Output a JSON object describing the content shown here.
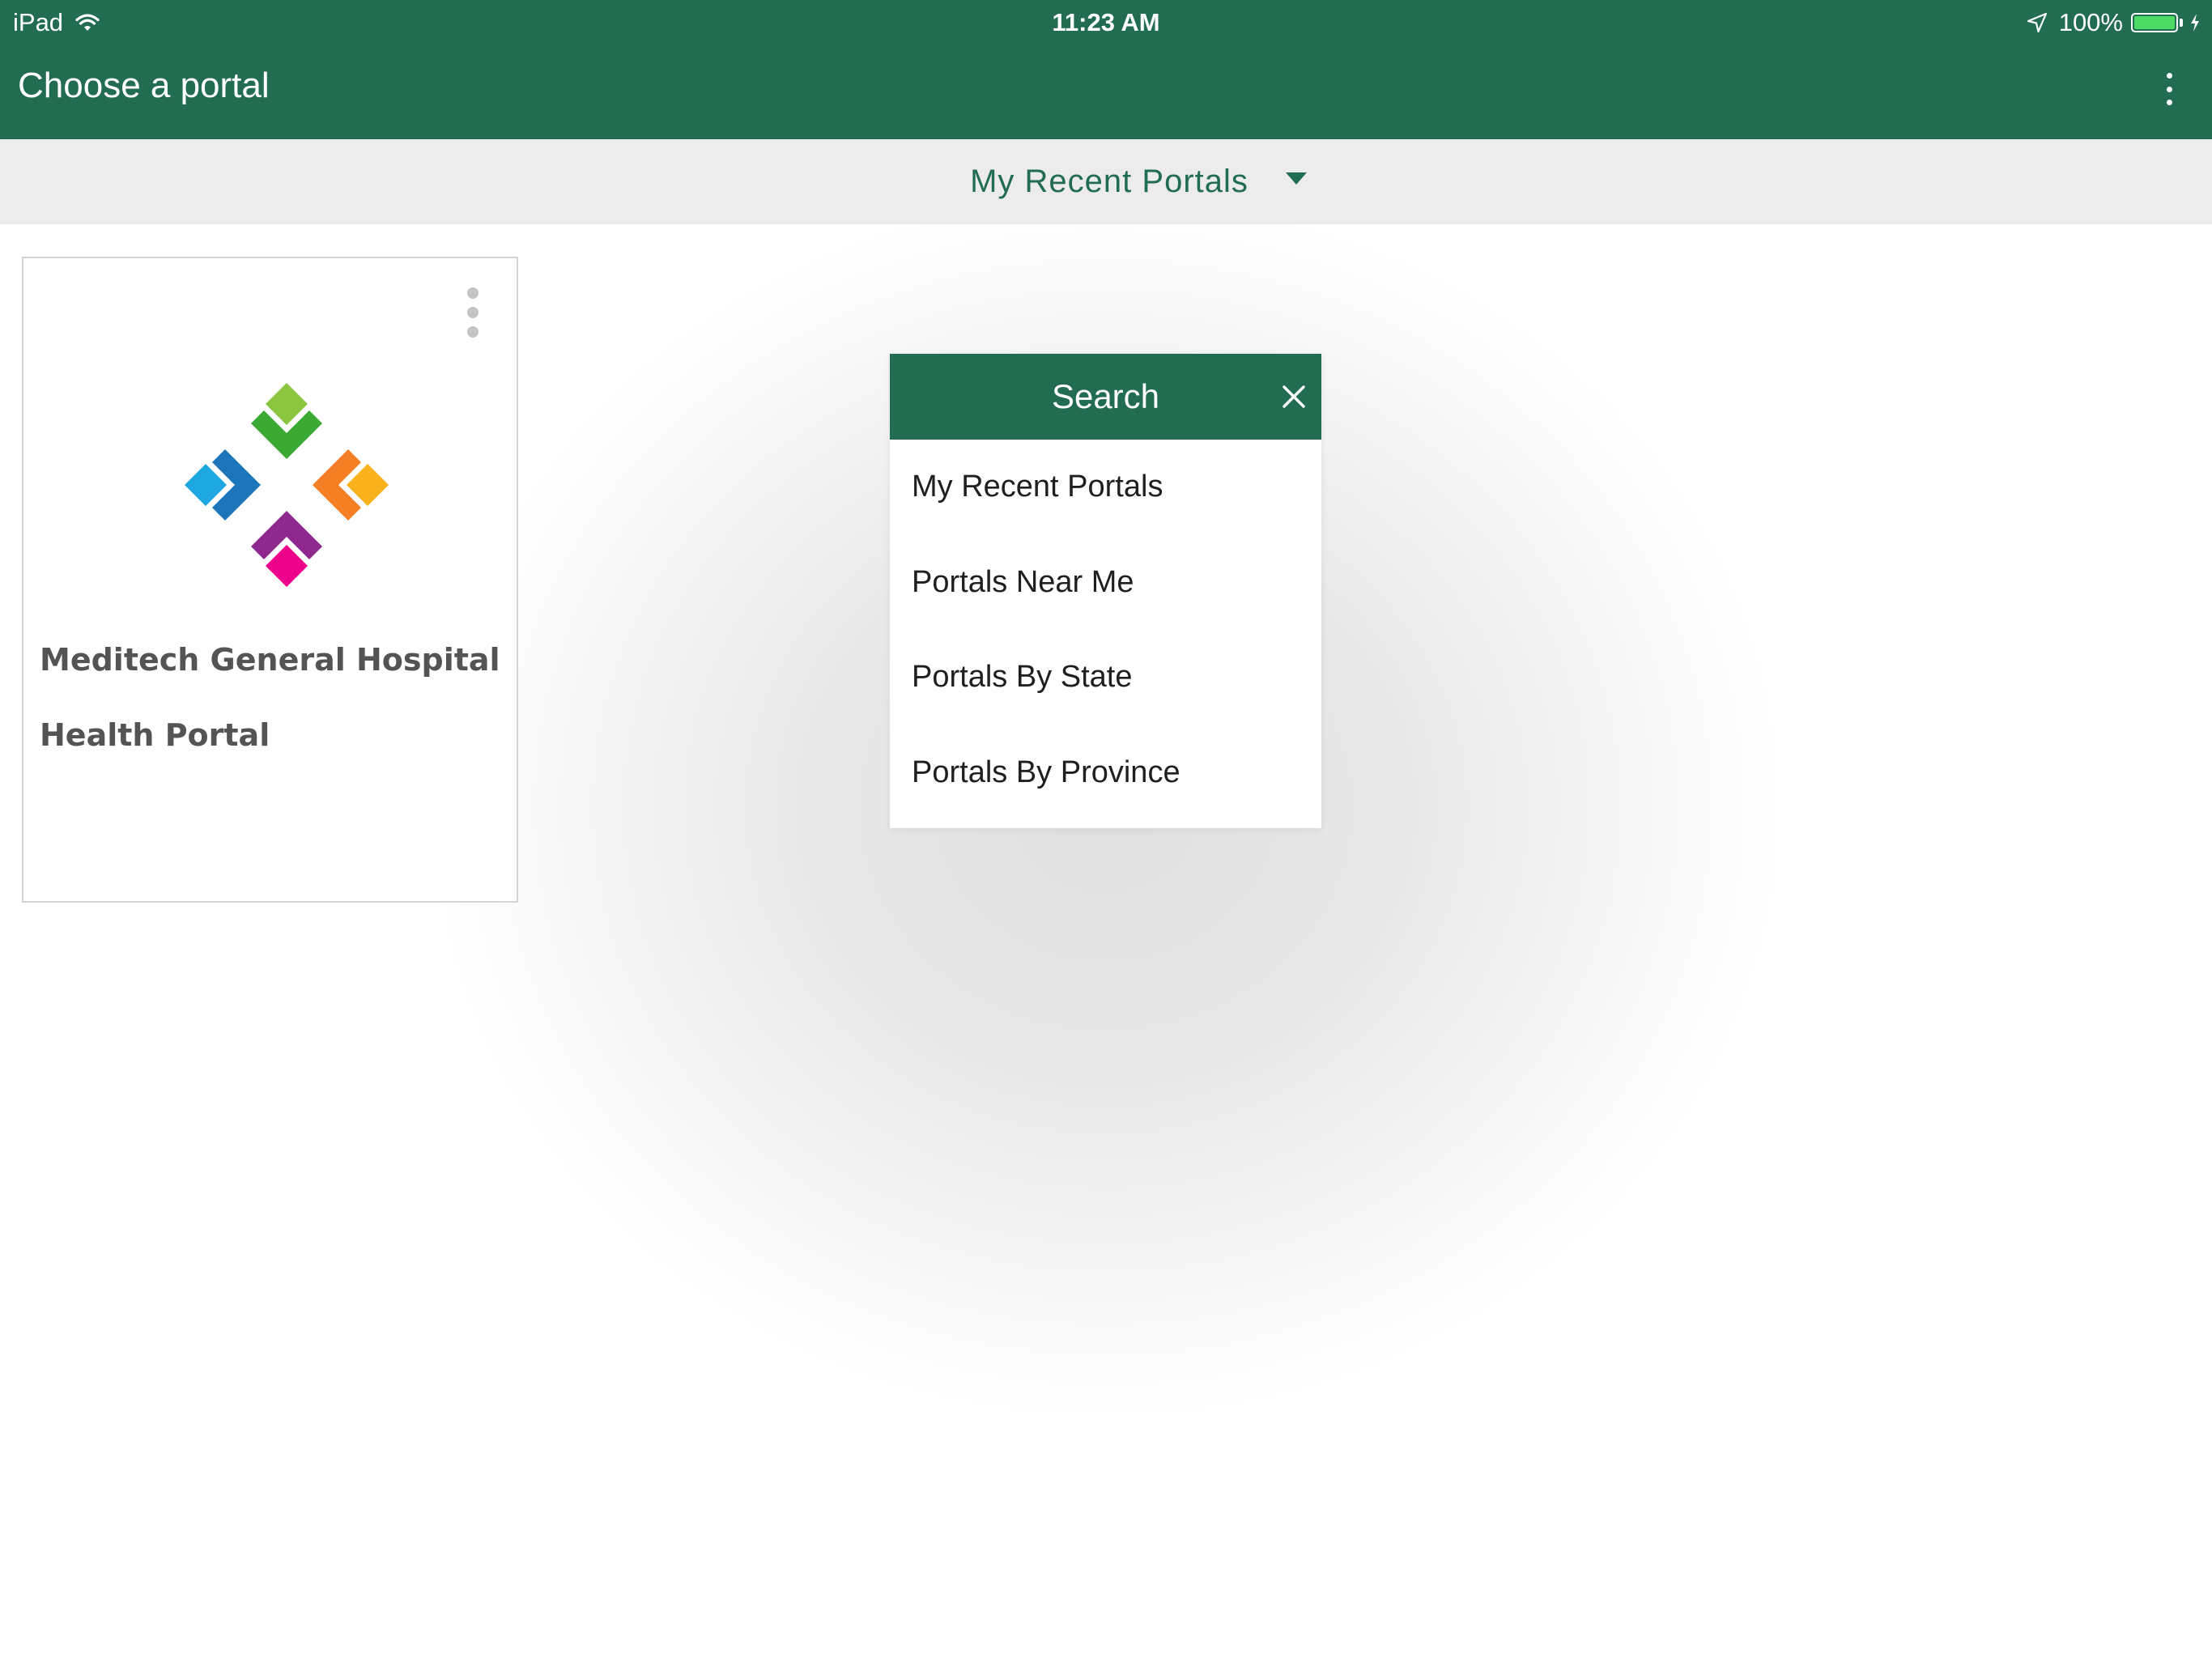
{
  "status_bar": {
    "device": "iPad",
    "time": "11:23 AM",
    "battery": "100%",
    "battery_level": 1.0,
    "battery_color": "#4cd964"
  },
  "header": {
    "title": "Choose a portal",
    "menu_icon": "more-vertical-icon",
    "background_color": "#226d51"
  },
  "filter": {
    "selected": "My Recent Portals",
    "icon": "caret-down-icon"
  },
  "portals": [
    {
      "name": "Meditech General Hospital Health Portal",
      "logo": "meditech-logo",
      "menu_icon": "more-vertical-icon"
    }
  ],
  "search_dialog": {
    "title": "Search",
    "close_icon": "close-icon",
    "options": [
      {
        "label": "My Recent Portals"
      },
      {
        "label": "Portals Near Me"
      },
      {
        "label": "Portals By State"
      },
      {
        "label": "Portals By Province"
      }
    ]
  }
}
